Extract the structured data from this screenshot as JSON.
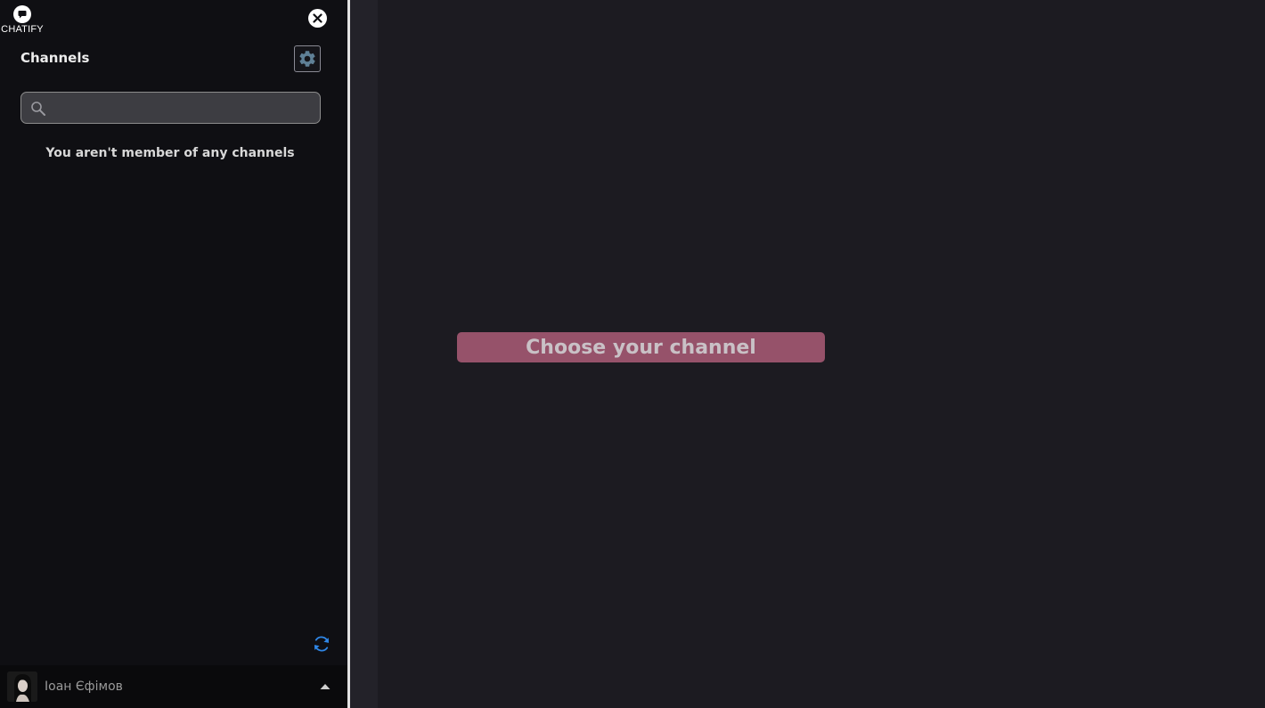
{
  "app": {
    "logo_text": "CHATIFY"
  },
  "sidebar": {
    "title": "Channels",
    "search_placeholder": "",
    "empty_message": "You aren't member of any channels"
  },
  "user": {
    "name": "Іоан Єфімов"
  },
  "main": {
    "choose_channel_label": "Choose your channel"
  },
  "colors": {
    "sidebar_bg": "#0f0f13",
    "main_bg": "#1c1b21",
    "accent_button": "#96526a",
    "refresh_icon": "#2f86e6"
  },
  "icons": {
    "logo": "chat-bubble-icon",
    "close": "close-icon",
    "settings": "gear-icon",
    "search": "search-icon",
    "refresh": "refresh-icon",
    "user_menu": "caret-up-icon"
  }
}
